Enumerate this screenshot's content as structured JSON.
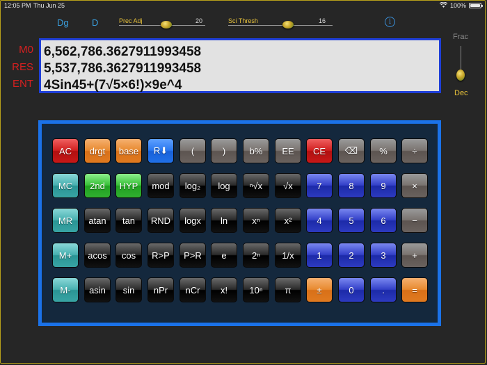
{
  "status_bar": {
    "time": "12:05 PM",
    "date": "Thu Jun 25",
    "battery": "100%"
  },
  "top_controls": {
    "dg_label": "Dg",
    "d_label": "D",
    "prec_adj": {
      "label": "Prec Adj",
      "value": "20"
    },
    "sci_thresh": {
      "label": "Sci Thresh",
      "value": "16"
    },
    "info_icon": "info-icon"
  },
  "registers": {
    "m0_label": "M0",
    "res_label": "RES",
    "ent_label": "ENT"
  },
  "display": {
    "m0": "6,562,786.3627911993458",
    "res": "5,537,786.3627911993458",
    "ent": "4Sin45+(7√5×6!)×9e^4"
  },
  "mode_switch": {
    "top_label": "Frac",
    "bottom_label": "Dec",
    "selected": "Dec"
  },
  "colors": {
    "accent_blue": "#1b72e8",
    "display_border": "#1f3fd8",
    "register_red": "#d62020",
    "label_gold": "#e8c23a"
  },
  "keys": {
    "ac": "AC",
    "drgt": "drgt",
    "base": "base",
    "r_down": "R⬇",
    "lparen": "(",
    "rparen": ")",
    "bpct": "b%",
    "ee": "EE",
    "ce": "CE",
    "backspace": "⌫",
    "pct": "%",
    "div": "÷",
    "mc": "MC",
    "second": "2nd",
    "hyp": "HYP",
    "mod": "mod",
    "log2": "log₂",
    "log": "log",
    "nroot": "ⁿ√x",
    "sqrt": "√x",
    "k7": "7",
    "k8": "8",
    "k9": "9",
    "mul": "×",
    "mr": "MR",
    "atan": "atan",
    "tan": "tan",
    "rnd": "RND",
    "logx": "logx",
    "ln": "ln",
    "xn": "xⁿ",
    "x2": "x²",
    "k4": "4",
    "k5": "5",
    "k6": "6",
    "minus": "−",
    "mplus": "M+",
    "acos": "acos",
    "cos": "cos",
    "r2p": "R>P",
    "p2r": "P>R",
    "e": "e",
    "twon": "2ⁿ",
    "inv": "1/x",
    "k1": "1",
    "k2": "2",
    "k3": "3",
    "plus": "+",
    "mminus": "M-",
    "asin": "asin",
    "sin": "sin",
    "npr": "nPr",
    "ncr": "nCr",
    "fact": "x!",
    "tenn": "10ⁿ",
    "pi": "π",
    "pm": "±",
    "k0": "0",
    "dot": ".",
    "eq": "="
  }
}
